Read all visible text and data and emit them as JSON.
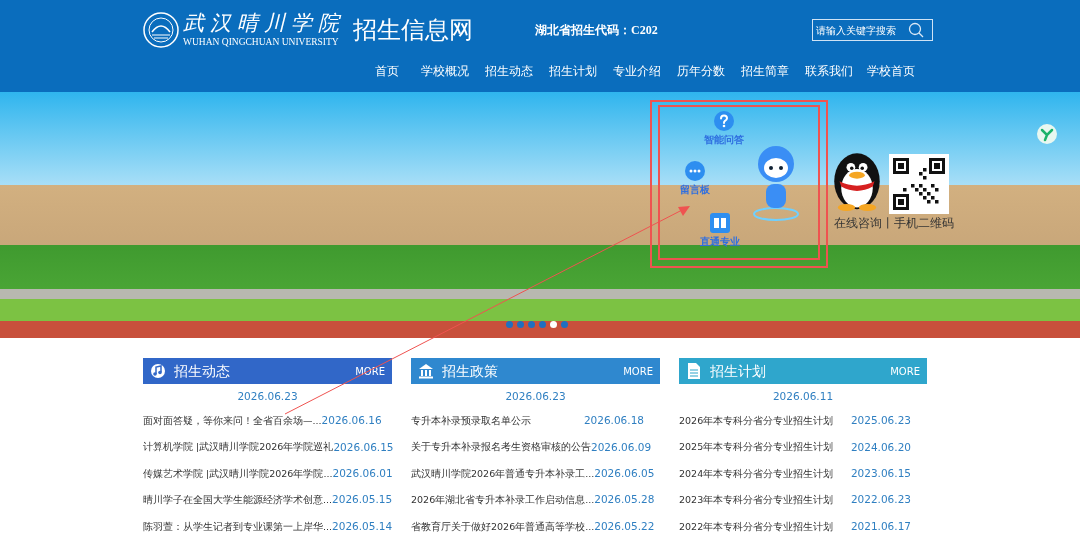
{
  "header": {
    "logo_name": "武汉晴川学院",
    "logo_english": "WUHAN QINGCHUAN UNIVERSITY",
    "site_title": "招生信息网",
    "code_label": "湖北省招生代码：C202",
    "search": {
      "placeholder": "请输入关键字搜索"
    }
  },
  "nav": [
    {
      "label": "首页"
    },
    {
      "label": "学校概况"
    },
    {
      "label": "招生动态"
    },
    {
      "label": "招生计划"
    },
    {
      "label": "专业介绍"
    },
    {
      "label": "历年分数"
    },
    {
      "label": "招生简章"
    },
    {
      "label": "联系我们"
    },
    {
      "label": "学校首页"
    }
  ],
  "banner": {
    "widgets": [
      {
        "kind": "question",
        "label": "智能问答"
      },
      {
        "kind": "chat",
        "label": "留言板"
      },
      {
        "kind": "book",
        "label": "直通专业"
      }
    ],
    "contact_caption": "在线咨询丨手机二维码",
    "dots": [
      {
        "selected": false
      },
      {
        "selected": false
      },
      {
        "selected": false
      },
      {
        "selected": false
      },
      {
        "selected": true
      },
      {
        "selected": false
      }
    ]
  },
  "sections": [
    {
      "kind": "music",
      "title": "招生动态",
      "more": "MORE",
      "color": "#3167c8",
      "featured_date": "2026.06.23",
      "items": [
        {
          "title": "面对面答疑，等你来问！全省百余场—...",
          "date": "2026.06.16"
        },
        {
          "title": "计算机学院 |武汉晴川学院2026年学院巡礼",
          "date": "2026.06.15"
        },
        {
          "title": "传媒艺术学院 |武汉晴川学院2026年学院...",
          "date": "2026.06.01"
        },
        {
          "title": "晴川学子在全国大学生能源经济学术创意...",
          "date": "2026.05.15"
        },
        {
          "title": "陈羽萱：从学生记者到专业课第一上岸华...",
          "date": "2026.05.14"
        }
      ]
    },
    {
      "kind": "bank",
      "title": "招生政策",
      "more": "MORE",
      "color": "#2f88cf",
      "featured_date": "2026.06.23",
      "items": [
        {
          "title": "专升本补录预录取名单公示",
          "date": "2026.06.18"
        },
        {
          "title": "关于专升本补录报名考生资格审核的公告",
          "date": "2026.06.09"
        },
        {
          "title": "武汉晴川学院2026年普通专升本补录工...",
          "date": "2026.06.05"
        },
        {
          "title": "2026年湖北省专升本补录工作启动信息...",
          "date": "2026.05.28"
        },
        {
          "title": "省教育厅关于做好2026年普通高等学校...",
          "date": "2026.05.22"
        }
      ]
    },
    {
      "kind": "document",
      "title": "招生计划",
      "more": "MORE",
      "color": "#2fa6cc",
      "featured_date": "2026.06.11",
      "items": [
        {
          "title": "2026年本专科分省分专业招生计划",
          "date": "2025.06.23"
        },
        {
          "title": "2025年本专科分省分专业招生计划",
          "date": "2024.06.20"
        },
        {
          "title": "2024年本专科分省分专业招生计划",
          "date": "2023.06.15"
        },
        {
          "title": "2023年本专科分省分专业招生计划",
          "date": "2022.06.23"
        },
        {
          "title": "2022年本专科分省分专业招生计划",
          "date": "2021.06.17"
        }
      ]
    }
  ]
}
